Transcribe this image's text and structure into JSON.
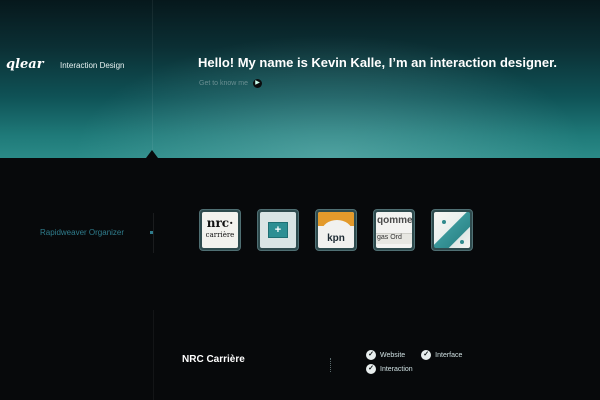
{
  "header": {
    "logo": "qlear",
    "tagline": "Interaction Design",
    "headline": "Hello! My name is Kevin Kalle, I’m an interaction designer.",
    "intro_link": "Get to know me"
  },
  "sidebar": {
    "organizer_label": "Rapidweaver Organizer"
  },
  "portfolio": {
    "thumbs": [
      {
        "name": "nrc",
        "line1": "nrc·",
        "line2": "carrière"
      },
      {
        "name": "plus",
        "symbol": "+"
      },
      {
        "name": "kpn",
        "text": "kpn"
      },
      {
        "name": "commerce",
        "line1": "qommer",
        "line2": "gas   Ord"
      },
      {
        "name": "map"
      }
    ]
  },
  "project": {
    "title": "NRC Carrière",
    "tags": [
      "Website",
      "Interface",
      "Interaction"
    ]
  },
  "icons": {
    "arrow": "arrow-right-icon",
    "check": "check-icon"
  },
  "colors": {
    "accent": "#2f8a8d",
    "link": "#2f7c8c",
    "background": "#07090b"
  }
}
